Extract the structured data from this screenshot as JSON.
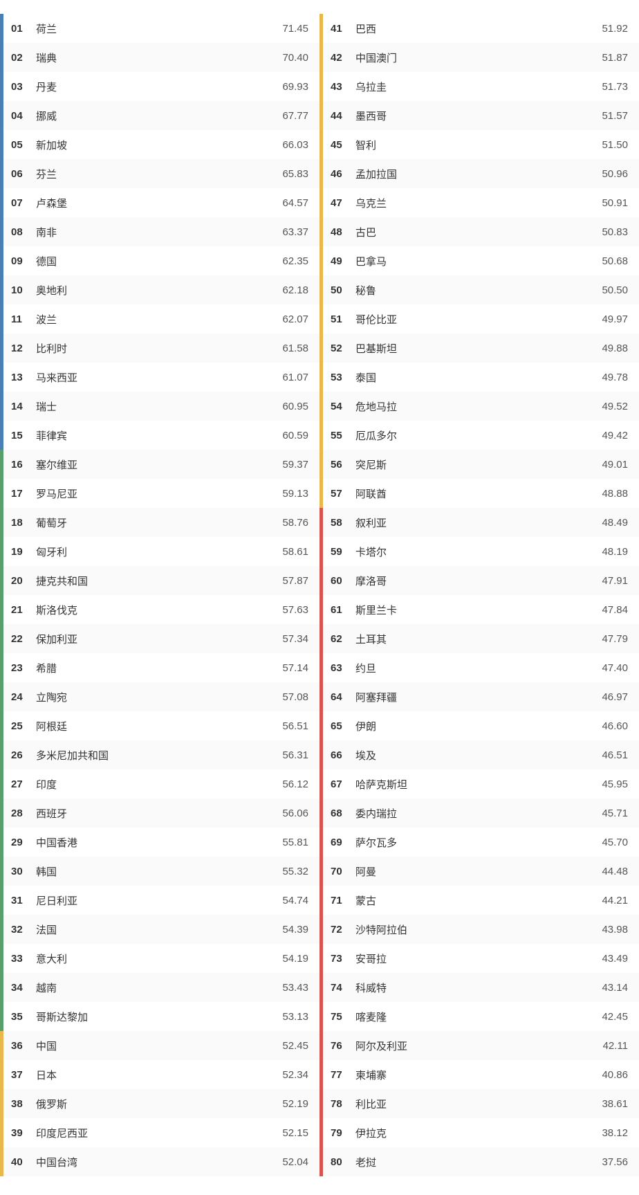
{
  "rankings": [
    {
      "rank": "01",
      "country": "荷兰",
      "score": "71.45",
      "color": "#4a7fb5"
    },
    {
      "rank": "02",
      "country": "瑞典",
      "score": "70.40",
      "color": "#4a7fb5"
    },
    {
      "rank": "03",
      "country": "丹麦",
      "score": "69.93",
      "color": "#4a7fb5"
    },
    {
      "rank": "04",
      "country": "挪威",
      "score": "67.77",
      "color": "#4a7fb5"
    },
    {
      "rank": "05",
      "country": "新加坡",
      "score": "66.03",
      "color": "#4a7fb5"
    },
    {
      "rank": "06",
      "country": "芬兰",
      "score": "65.83",
      "color": "#4a7fb5"
    },
    {
      "rank": "07",
      "country": "卢森堡",
      "score": "64.57",
      "color": "#4a7fb5"
    },
    {
      "rank": "08",
      "country": "南非",
      "score": "63.37",
      "color": "#4a7fb5"
    },
    {
      "rank": "09",
      "country": "德国",
      "score": "62.35",
      "color": "#4a7fb5"
    },
    {
      "rank": "10",
      "country": "奥地利",
      "score": "62.18",
      "color": "#4a7fb5"
    },
    {
      "rank": "11",
      "country": "波兰",
      "score": "62.07",
      "color": "#4a7fb5"
    },
    {
      "rank": "12",
      "country": "比利时",
      "score": "61.58",
      "color": "#4a7fb5"
    },
    {
      "rank": "13",
      "country": "马来西亚",
      "score": "61.07",
      "color": "#4a7fb5"
    },
    {
      "rank": "14",
      "country": "瑞士",
      "score": "60.95",
      "color": "#4a7fb5"
    },
    {
      "rank": "15",
      "country": "菲律宾",
      "score": "60.59",
      "color": "#4a7fb5"
    },
    {
      "rank": "16",
      "country": "塞尔维亚",
      "score": "59.37",
      "color": "#5b9e6e"
    },
    {
      "rank": "17",
      "country": "罗马尼亚",
      "score": "59.13",
      "color": "#5b9e6e"
    },
    {
      "rank": "18",
      "country": "葡萄牙",
      "score": "58.76",
      "color": "#5b9e6e"
    },
    {
      "rank": "19",
      "country": "匈牙利",
      "score": "58.61",
      "color": "#5b9e6e"
    },
    {
      "rank": "20",
      "country": "捷克共和国",
      "score": "57.87",
      "color": "#5b9e6e"
    },
    {
      "rank": "21",
      "country": "斯洛伐克",
      "score": "57.63",
      "color": "#5b9e6e"
    },
    {
      "rank": "22",
      "country": "保加利亚",
      "score": "57.34",
      "color": "#5b9e6e"
    },
    {
      "rank": "23",
      "country": "希腊",
      "score": "57.14",
      "color": "#5b9e6e"
    },
    {
      "rank": "24",
      "country": "立陶宛",
      "score": "57.08",
      "color": "#5b9e6e"
    },
    {
      "rank": "25",
      "country": "阿根廷",
      "score": "56.51",
      "color": "#5b9e6e"
    },
    {
      "rank": "26",
      "country": "多米尼加共和国",
      "score": "56.31",
      "color": "#5b9e6e"
    },
    {
      "rank": "27",
      "country": "印度",
      "score": "56.12",
      "color": "#5b9e6e"
    },
    {
      "rank": "28",
      "country": "西班牙",
      "score": "56.06",
      "color": "#5b9e6e"
    },
    {
      "rank": "29",
      "country": "中国香港",
      "score": "55.81",
      "color": "#5b9e6e"
    },
    {
      "rank": "30",
      "country": "韩国",
      "score": "55.32",
      "color": "#5b9e6e"
    },
    {
      "rank": "31",
      "country": "尼日利亚",
      "score": "54.74",
      "color": "#5b9e6e"
    },
    {
      "rank": "32",
      "country": "法国",
      "score": "54.39",
      "color": "#5b9e6e"
    },
    {
      "rank": "33",
      "country": "意大利",
      "score": "54.19",
      "color": "#5b9e6e"
    },
    {
      "rank": "34",
      "country": "越南",
      "score": "53.43",
      "color": "#5b9e6e"
    },
    {
      "rank": "35",
      "country": "哥斯达黎加",
      "score": "53.13",
      "color": "#5b9e6e"
    },
    {
      "rank": "36",
      "country": "中国",
      "score": "52.45",
      "color": "#e8b84b"
    },
    {
      "rank": "37",
      "country": "日本",
      "score": "52.34",
      "color": "#e8b84b"
    },
    {
      "rank": "38",
      "country": "俄罗斯",
      "score": "52.19",
      "color": "#e8b84b"
    },
    {
      "rank": "39",
      "country": "印度尼西亚",
      "score": "52.15",
      "color": "#e8b84b"
    },
    {
      "rank": "40",
      "country": "中国台湾",
      "score": "52.04",
      "color": "#e8b84b"
    },
    {
      "rank": "41",
      "country": "巴西",
      "score": "51.92",
      "color": "#e8b84b"
    },
    {
      "rank": "42",
      "country": "中国澳门",
      "score": "51.87",
      "color": "#e8b84b"
    },
    {
      "rank": "43",
      "country": "乌拉圭",
      "score": "51.73",
      "color": "#e8b84b"
    },
    {
      "rank": "44",
      "country": "墨西哥",
      "score": "51.57",
      "color": "#e8b84b"
    },
    {
      "rank": "45",
      "country": "智利",
      "score": "51.50",
      "color": "#e8b84b"
    },
    {
      "rank": "46",
      "country": "孟加拉国",
      "score": "50.96",
      "color": "#e8b84b"
    },
    {
      "rank": "47",
      "country": "乌克兰",
      "score": "50.91",
      "color": "#e8b84b"
    },
    {
      "rank": "48",
      "country": "古巴",
      "score": "50.83",
      "color": "#e8b84b"
    },
    {
      "rank": "49",
      "country": "巴拿马",
      "score": "50.68",
      "color": "#e8b84b"
    },
    {
      "rank": "50",
      "country": "秘鲁",
      "score": "50.50",
      "color": "#e8b84b"
    },
    {
      "rank": "51",
      "country": "哥伦比亚",
      "score": "49.97",
      "color": "#e8b84b"
    },
    {
      "rank": "52",
      "country": "巴基斯坦",
      "score": "49.88",
      "color": "#e8b84b"
    },
    {
      "rank": "53",
      "country": "泰国",
      "score": "49.78",
      "color": "#e8b84b"
    },
    {
      "rank": "54",
      "country": "危地马拉",
      "score": "49.52",
      "color": "#e8b84b"
    },
    {
      "rank": "55",
      "country": "厄瓜多尔",
      "score": "49.42",
      "color": "#e8b84b"
    },
    {
      "rank": "56",
      "country": "突尼斯",
      "score": "49.01",
      "color": "#e8b84b"
    },
    {
      "rank": "57",
      "country": "阿联酋",
      "score": "48.88",
      "color": "#e8b84b"
    },
    {
      "rank": "58",
      "country": "叙利亚",
      "score": "48.49",
      "color": "#d9534f"
    },
    {
      "rank": "59",
      "country": "卡塔尔",
      "score": "48.19",
      "color": "#d9534f"
    },
    {
      "rank": "60",
      "country": "摩洛哥",
      "score": "47.91",
      "color": "#d9534f"
    },
    {
      "rank": "61",
      "country": "斯里兰卡",
      "score": "47.84",
      "color": "#d9534f"
    },
    {
      "rank": "62",
      "country": "土耳其",
      "score": "47.79",
      "color": "#d9534f"
    },
    {
      "rank": "63",
      "country": "约旦",
      "score": "47.40",
      "color": "#d9534f"
    },
    {
      "rank": "64",
      "country": "阿塞拜疆",
      "score": "46.97",
      "color": "#d9534f"
    },
    {
      "rank": "65",
      "country": "伊朗",
      "score": "46.60",
      "color": "#d9534f"
    },
    {
      "rank": "66",
      "country": "埃及",
      "score": "46.51",
      "color": "#d9534f"
    },
    {
      "rank": "67",
      "country": "哈萨克斯坦",
      "score": "45.95",
      "color": "#d9534f"
    },
    {
      "rank": "68",
      "country": "委内瑞拉",
      "score": "45.71",
      "color": "#d9534f"
    },
    {
      "rank": "69",
      "country": "萨尔瓦多",
      "score": "45.70",
      "color": "#d9534f"
    },
    {
      "rank": "70",
      "country": "阿曼",
      "score": "44.48",
      "color": "#d9534f"
    },
    {
      "rank": "71",
      "country": "蒙古",
      "score": "44.21",
      "color": "#d9534f"
    },
    {
      "rank": "72",
      "country": "沙特阿拉伯",
      "score": "43.98",
      "color": "#d9534f"
    },
    {
      "rank": "73",
      "country": "安哥拉",
      "score": "43.49",
      "color": "#d9534f"
    },
    {
      "rank": "74",
      "country": "科威特",
      "score": "43.14",
      "color": "#d9534f"
    },
    {
      "rank": "75",
      "country": "喀麦隆",
      "score": "42.45",
      "color": "#d9534f"
    },
    {
      "rank": "76",
      "country": "阿尔及利亚",
      "score": "42.11",
      "color": "#d9534f"
    },
    {
      "rank": "77",
      "country": "柬埔寨",
      "score": "40.86",
      "color": "#d9534f"
    },
    {
      "rank": "78",
      "country": "利比亚",
      "score": "38.61",
      "color": "#d9534f"
    },
    {
      "rank": "79",
      "country": "伊拉克",
      "score": "38.12",
      "color": "#d9534f"
    },
    {
      "rank": "80",
      "country": "老挝",
      "score": "37.56",
      "color": "#d9534f"
    }
  ]
}
